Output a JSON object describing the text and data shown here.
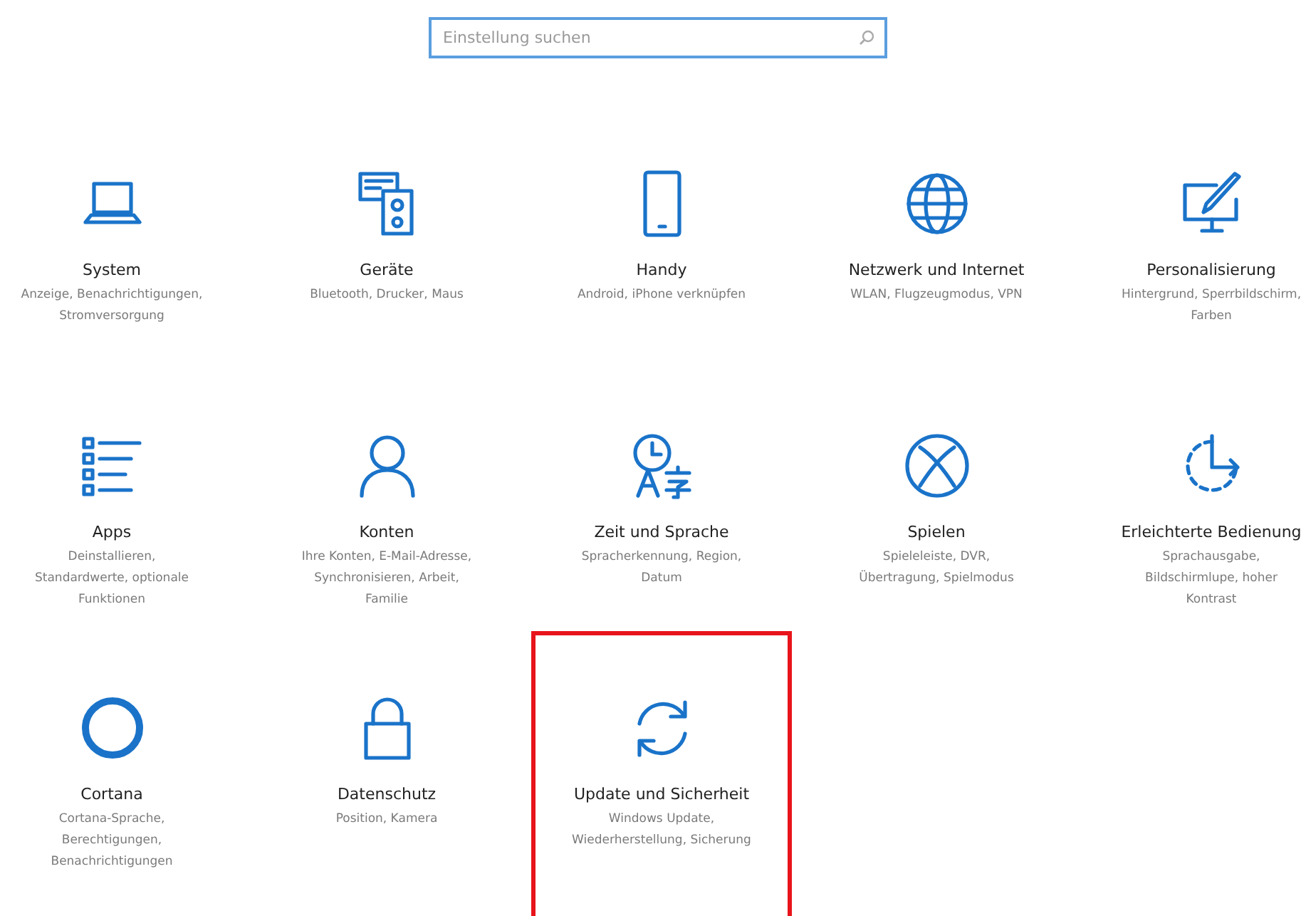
{
  "search": {
    "placeholder": "Einstellung suchen"
  },
  "tiles": [
    {
      "title": "System",
      "description": "Anzeige, Benachrichtigungen, Stromversorgung",
      "highlighted": false
    },
    {
      "title": "Geräte",
      "description": "Bluetooth, Drucker, Maus",
      "highlighted": false
    },
    {
      "title": "Handy",
      "description": "Android, iPhone verknüpfen",
      "highlighted": false
    },
    {
      "title": "Netzwerk und Internet",
      "description": "WLAN, Flugzeugmodus, VPN",
      "highlighted": false
    },
    {
      "title": "Personalisierung",
      "description": "Hintergrund, Sperrbildschirm, Farben",
      "highlighted": false
    },
    {
      "title": "Apps",
      "description": "Deinstallieren, Standardwerte, optionale Funktionen",
      "highlighted": false
    },
    {
      "title": "Konten",
      "description": "Ihre Konten, E-Mail-Adresse, Synchronisieren, Arbeit, Familie",
      "highlighted": false
    },
    {
      "title": "Zeit und Sprache",
      "description": "Spracherkennung, Region, Datum",
      "highlighted": false
    },
    {
      "title": "Spielen",
      "description": "Spieleleiste, DVR, Übertragung, Spielmodus",
      "highlighted": false
    },
    {
      "title": "Erleichterte Bedienung",
      "description": "Sprachausgabe, Bildschirmlupe, hoher Kontrast",
      "highlighted": false
    },
    {
      "title": "Cortana",
      "description": "Cortana-Sprache, Berechtigungen, Benachrichtigungen",
      "highlighted": false
    },
    {
      "title": "Datenschutz",
      "description": "Position, Kamera",
      "highlighted": false
    },
    {
      "title": "Update und Sicherheit",
      "description": "Windows Update, Wiederherstellung, Sicherung",
      "highlighted": true
    }
  ]
}
